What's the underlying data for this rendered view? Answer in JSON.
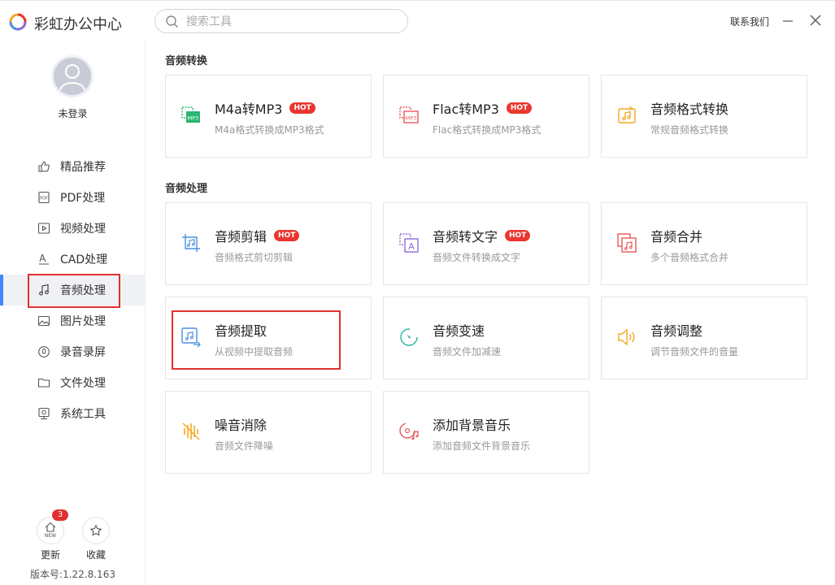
{
  "app": {
    "title": "彩虹办公中心"
  },
  "search": {
    "placeholder": "搜索工具"
  },
  "header": {
    "contact": "联系我们"
  },
  "user": {
    "label": "未登录"
  },
  "sidebar": {
    "items": [
      {
        "label": "精品推荐",
        "icon": "thumbs-up-icon"
      },
      {
        "label": "PDF处理",
        "icon": "pdf-icon"
      },
      {
        "label": "视频处理",
        "icon": "video-icon"
      },
      {
        "label": "CAD处理",
        "icon": "cad-icon"
      },
      {
        "label": "音频处理",
        "icon": "music-icon",
        "active": true
      },
      {
        "label": "图片处理",
        "icon": "image-icon"
      },
      {
        "label": "录音录屏",
        "icon": "record-icon"
      },
      {
        "label": "文件处理",
        "icon": "folder-icon"
      },
      {
        "label": "系统工具",
        "icon": "system-tool-icon"
      }
    ],
    "update_label": "更新",
    "update_badge": "3",
    "update_icon_text": "NEW",
    "favorites_label": "收藏",
    "version": "版本号:1.22.8.163"
  },
  "sections": [
    {
      "title": "音频转换",
      "cards": [
        {
          "title": "M4a转MP3",
          "hot": "HOT",
          "desc": "M4a格式转换成MP3格式",
          "icon": "m4a-to-mp3-icon",
          "icon_text": "MP3"
        },
        {
          "title": "Flac转MP3",
          "hot": "HOT",
          "desc": "Flac格式转换成MP3格式",
          "icon": "flac-to-mp3-icon",
          "icon_text": "MP3"
        },
        {
          "title": "音频格式转换",
          "desc": "常规音频格式转换",
          "icon": "audio-convert-icon"
        }
      ]
    },
    {
      "title": "音频处理",
      "cards": [
        {
          "title": "音频剪辑",
          "hot": "HOT",
          "desc": "音频格式剪切剪辑",
          "icon": "audio-cut-icon"
        },
        {
          "title": "音频转文字",
          "hot": "HOT",
          "desc": "音频文件转换成文字",
          "icon": "audio-to-text-icon",
          "icon_text": "A"
        },
        {
          "title": "音频合并",
          "desc": "多个音频格式合并",
          "icon": "audio-merge-icon"
        },
        {
          "title": "音频提取",
          "desc": "从视频中提取音频",
          "icon": "audio-extract-icon"
        },
        {
          "title": "音频变速",
          "desc": "音频文件加减速",
          "icon": "audio-speed-icon"
        },
        {
          "title": "音频调整",
          "desc": "调节音频文件的音量",
          "icon": "volume-icon"
        },
        {
          "title": "噪音消除",
          "desc": "音频文件降噪",
          "icon": "noise-reduction-icon"
        },
        {
          "title": "添加背景音乐",
          "desc": "添加音频文件背景音乐",
          "icon": "background-music-icon"
        }
      ]
    }
  ],
  "colors": {
    "accent": "#3f86ff",
    "highlight_border": "#e0302f",
    "hot_badge": "#e9372f",
    "green": "#2bb673",
    "red": "#e8595a",
    "orange": "#f5a623",
    "blue": "#4a90e2",
    "purple": "#8e6cd8",
    "teal": "#2ab3a6"
  }
}
